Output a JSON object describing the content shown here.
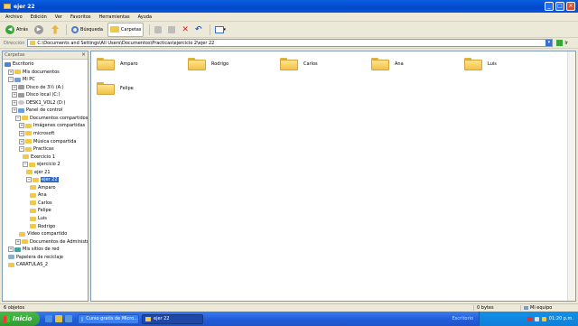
{
  "window": {
    "title": "ejer 22",
    "minimize_glyph": "_",
    "maximize_glyph": "□",
    "close_glyph": "✕"
  },
  "menu": [
    "Archivo",
    "Edición",
    "Ver",
    "Favoritos",
    "Herramientas",
    "Ayuda"
  ],
  "toolbar": {
    "back_label": "Atrás",
    "search_label": "Búsqueda",
    "folders_label": "Carpetas"
  },
  "address": {
    "label": "Dirección",
    "value": "C:\\Documents and Settings\\All Users\\Documentos\\Practicas\\ejercicio 2\\ejer 22",
    "go_label": "Ir"
  },
  "folders_pane": {
    "title": "Carpetas",
    "close_glyph": "×",
    "nodes": [
      {
        "label": "Escritorio",
        "icon": "desktop-icon",
        "expander": ""
      },
      {
        "label": "Mis documentos",
        "icon": "folder-icon",
        "expander": "+"
      },
      {
        "label": "Mi PC",
        "icon": "computer-icon",
        "expander": "−"
      },
      {
        "label": "Disco de 3½ (A:)",
        "icon": "floppy-icon",
        "expander": "+"
      },
      {
        "label": "Disco local (C:)",
        "icon": "drive-icon",
        "expander": "+"
      },
      {
        "label": "DESK1_VOL2 (D:)",
        "icon": "cd-icon",
        "expander": "+"
      },
      {
        "label": "Panel de control",
        "icon": "control-panel-icon",
        "expander": "+"
      },
      {
        "label": "Documentos compartidos",
        "icon": "folder-icon",
        "expander": "−"
      },
      {
        "label": "Imágenes compartidas",
        "icon": "folder-icon",
        "expander": "+"
      },
      {
        "label": "microsoft",
        "icon": "folder-icon",
        "expander": "+"
      },
      {
        "label": "Música compartida",
        "icon": "folder-icon",
        "expander": "+"
      },
      {
        "label": "Practicas",
        "icon": "folder-icon",
        "expander": "−"
      },
      {
        "label": "Exercicio 1",
        "icon": "folder-icon",
        "expander": ""
      },
      {
        "label": "ejercicio 2",
        "icon": "folder-icon",
        "expander": "−"
      },
      {
        "label": "ejer 21",
        "icon": "folder-icon",
        "expander": ""
      },
      {
        "label": "ejer 22",
        "icon": "folder-icon",
        "expander": "−"
      },
      {
        "label": "Amparo",
        "icon": "folder-icon",
        "expander": ""
      },
      {
        "label": "Ana",
        "icon": "folder-icon",
        "expander": ""
      },
      {
        "label": "Carlos",
        "icon": "folder-icon",
        "expander": ""
      },
      {
        "label": "Felipe",
        "icon": "folder-icon",
        "expander": ""
      },
      {
        "label": "Luis",
        "icon": "folder-icon",
        "expander": ""
      },
      {
        "label": "Rodrigo",
        "icon": "folder-icon",
        "expander": ""
      },
      {
        "label": "Vídeo compartido",
        "icon": "folder-icon",
        "expander": ""
      },
      {
        "label": "Documentos de Administrador",
        "icon": "folder-icon",
        "expander": "+"
      },
      {
        "label": "Mis sitios de red",
        "icon": "network-icon",
        "expander": "+"
      },
      {
        "label": "Papelera de reciclaje",
        "icon": "recycle-bin-icon",
        "expander": ""
      },
      {
        "label": "CARATULAS_2",
        "icon": "folder-icon",
        "expander": ""
      }
    ],
    "selected": "ejer 22"
  },
  "files": [
    "Amparo",
    "Rodrigo",
    "Carlos",
    "Ana",
    "Luis",
    "Felipe"
  ],
  "status": {
    "objects": "6 objetos",
    "size": "0 bytes",
    "location": "Mi equipo"
  },
  "taskbar": {
    "start_label": "Inicio",
    "tasks": [
      {
        "label": "Curso gratis de Micro...",
        "active": false
      },
      {
        "label": "ejer 22",
        "active": true
      }
    ],
    "tray_label": "Escritorio",
    "clock": "01:20 p.m."
  }
}
